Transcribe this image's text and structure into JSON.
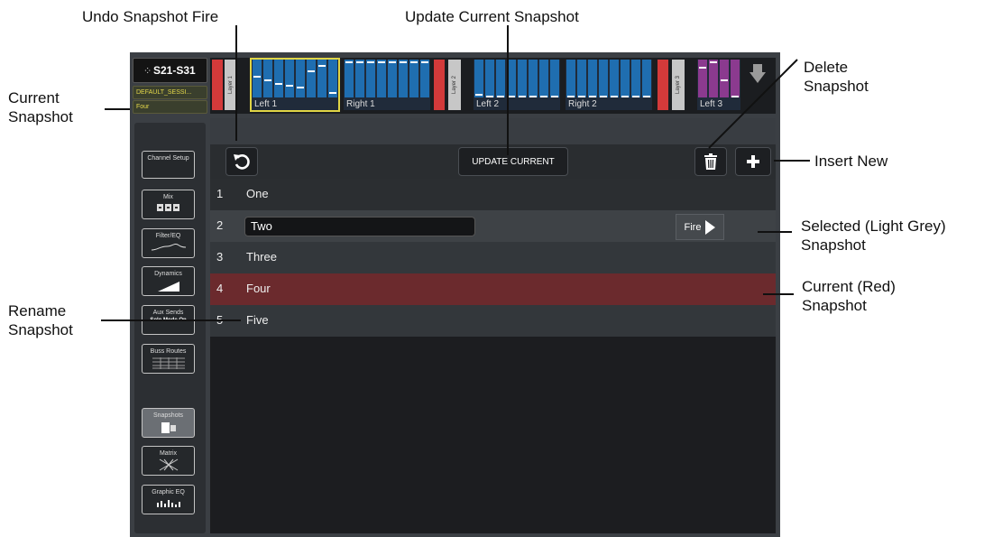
{
  "annotations": {
    "undo_fire": "Undo Snapshot Fire",
    "update_current": "Update Current Snapshot",
    "delete": "Delete\nSnapshot",
    "current_snapshot": "Current\nSnapshot",
    "insert_new": "Insert New",
    "selected": "Selected (Light Grey)\nSnapshot",
    "current_red": "Current (Red)\nSnapshot",
    "rename": "Rename\nSnapshot"
  },
  "header": {
    "logo": "S21-S31",
    "session": "DEFAULT_SESSI...",
    "current_snapshot": "Four"
  },
  "layers": [
    {
      "tab": "Layer 1"
    },
    {
      "tab": "Layer 2"
    },
    {
      "tab": "Layer 3"
    }
  ],
  "fader_groups": {
    "left1": "Left 1",
    "right1": "Right 1",
    "left2": "Left 2",
    "right2": "Right 2",
    "left3": "Left 3"
  },
  "sidebar": {
    "channel_setup": "Channel Setup",
    "mix": "Mix",
    "filter_eq": "Filter/EQ",
    "dynamics": "Dynamics",
    "aux_sends": "Aux Sends",
    "solo_mode": "Solo Mode On",
    "buss_routes": "Buss Routes",
    "snapshots": "Snapshots",
    "matrix": "Matrix",
    "graphic_eq": "Graphic EQ"
  },
  "toolbar": {
    "update_current": "UPDATE CURRENT"
  },
  "snapshots": [
    {
      "num": "1",
      "name": "One"
    },
    {
      "num": "2",
      "name": "Two"
    },
    {
      "num": "3",
      "name": "Three"
    },
    {
      "num": "4",
      "name": "Four"
    },
    {
      "num": "5",
      "name": "Five"
    }
  ],
  "fire_label": "Fire",
  "colors": {
    "current_row": "#6b2a2d",
    "selected_row": "#3e4246",
    "layer_red": "#d33a3a",
    "fader_blue": "#1f6eb0",
    "layer3_purple": "#8b3a8f",
    "selected_outline": "#e0d545"
  }
}
